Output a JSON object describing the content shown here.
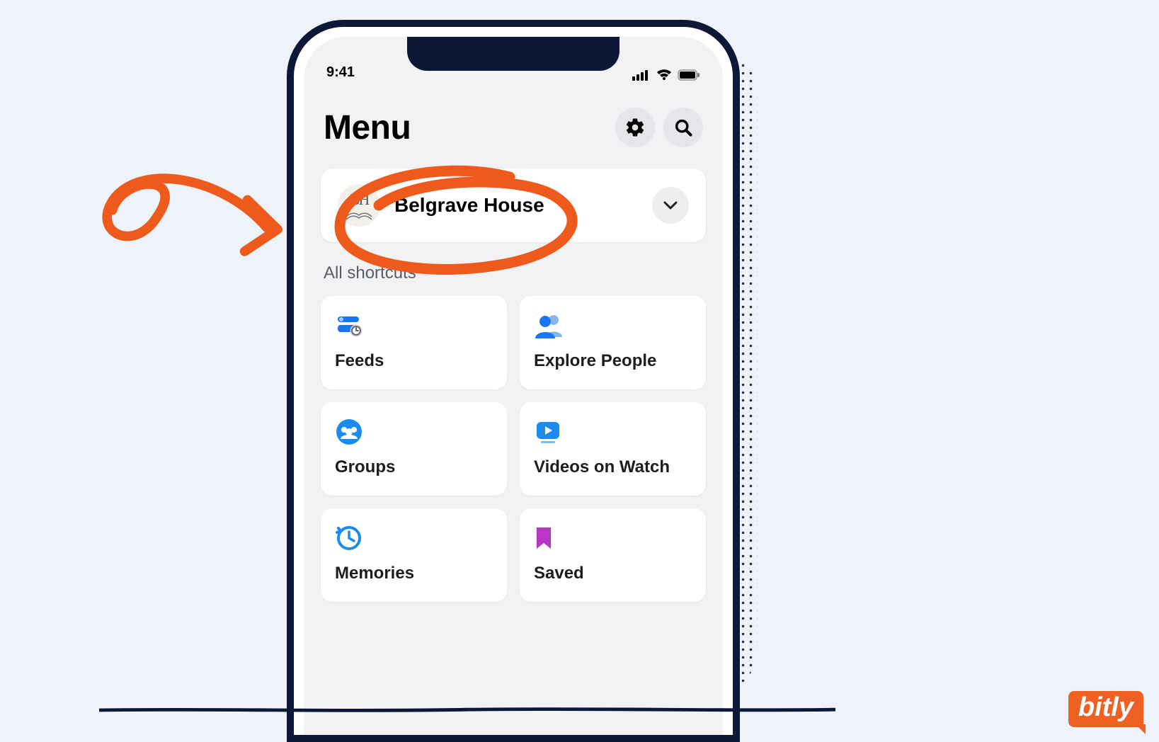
{
  "status": {
    "time": "9:41"
  },
  "header": {
    "title": "Menu"
  },
  "account": {
    "initials": "BH",
    "name": "Belgrave House"
  },
  "section_label": "All shortcuts",
  "tiles": [
    {
      "label": "Feeds"
    },
    {
      "label": "Explore People"
    },
    {
      "label": "Groups"
    },
    {
      "label": "Videos on Watch"
    },
    {
      "label": "Memories"
    },
    {
      "label": "Saved"
    }
  ],
  "badge": "bitly"
}
